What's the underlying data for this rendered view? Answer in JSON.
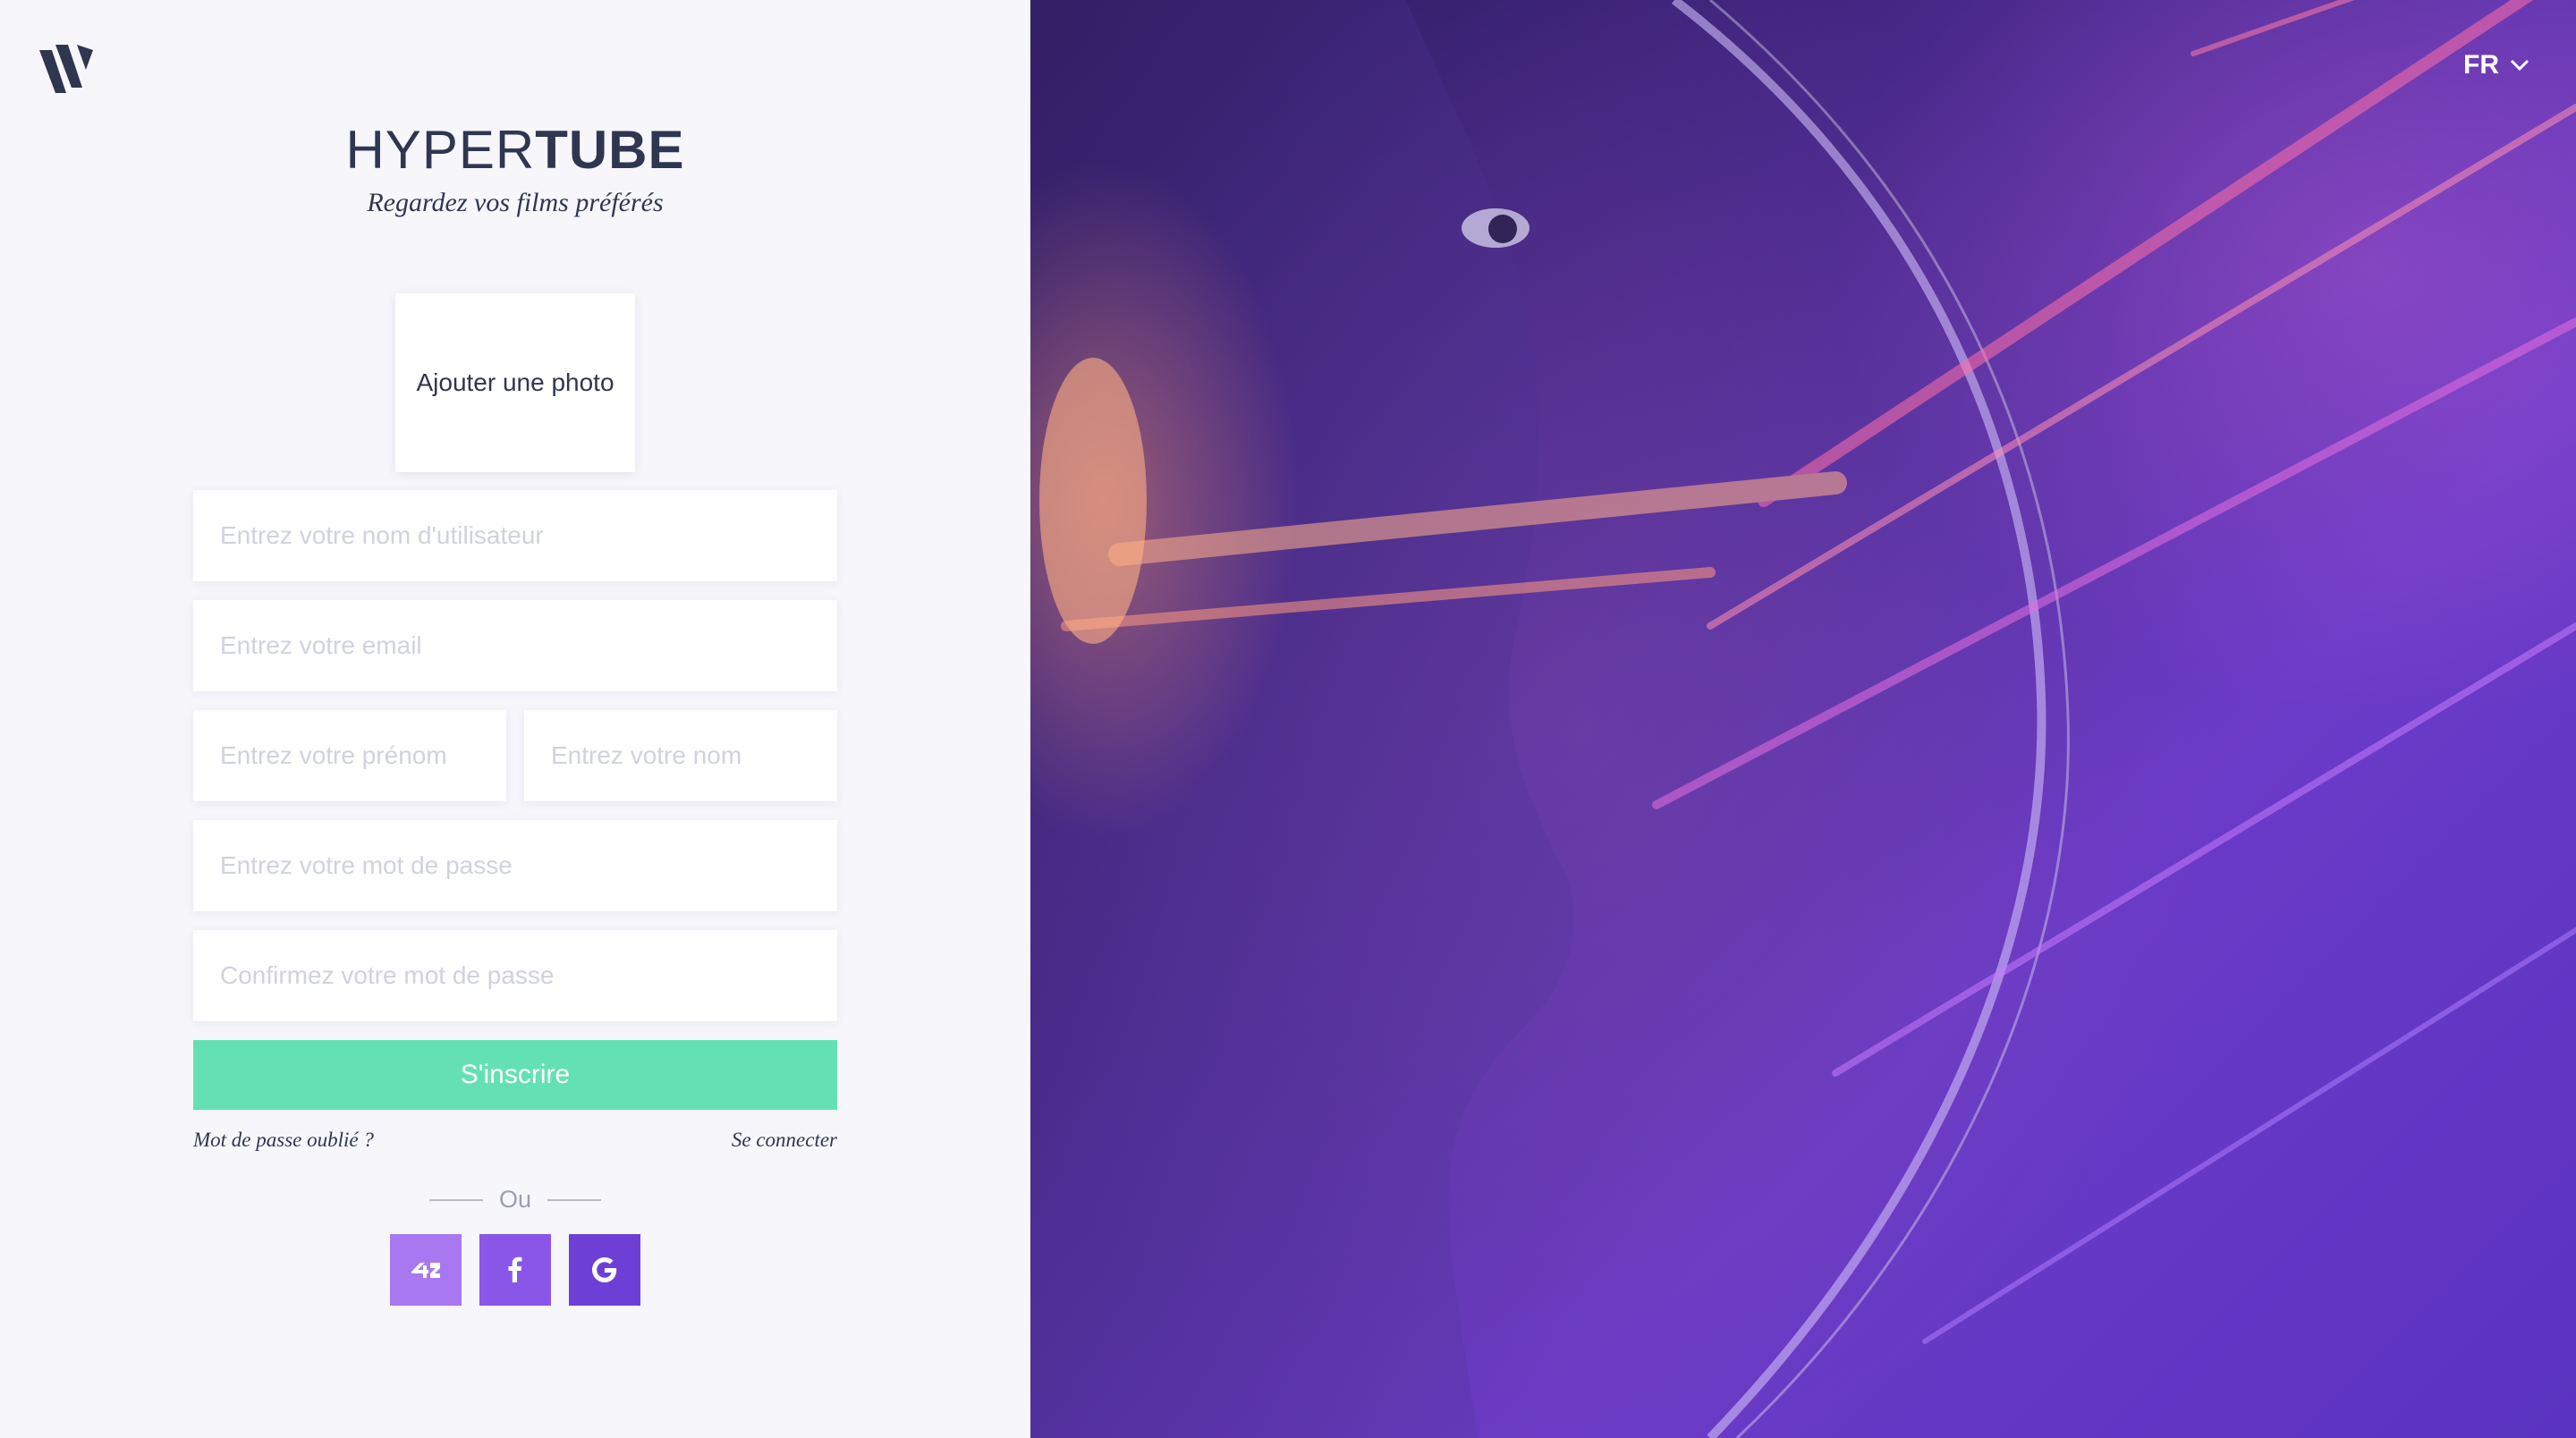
{
  "brand": {
    "title_light": "HYPER",
    "title_bold": "TUBE",
    "subtitle": "Regardez vos films préférés"
  },
  "photo": {
    "label": "Ajouter une photo"
  },
  "form": {
    "username_placeholder": "Entrez votre nom d'utilisateur",
    "email_placeholder": "Entrez votre email",
    "firstname_placeholder": "Entrez votre prénom",
    "lastname_placeholder": "Entrez votre nom",
    "password_placeholder": "Entrez votre mot de passe",
    "confirm_placeholder": "Confirmez votre mot de passe",
    "submit_label": "S'inscrire"
  },
  "links": {
    "forgot": "Mot de passe oublié ?",
    "login": "Se connecter"
  },
  "divider": {
    "label": "Ou"
  },
  "socials": [
    {
      "icon": "42-icon",
      "color": "#a778f0"
    },
    {
      "icon": "facebook-icon",
      "color": "#8a56e8"
    },
    {
      "icon": "google-icon",
      "color": "#6e3fd6"
    }
  ],
  "language": {
    "current": "FR"
  },
  "colors": {
    "accent_green": "#64e1b4",
    "text_dark": "#2f3650",
    "background": "#f6f6fb"
  }
}
